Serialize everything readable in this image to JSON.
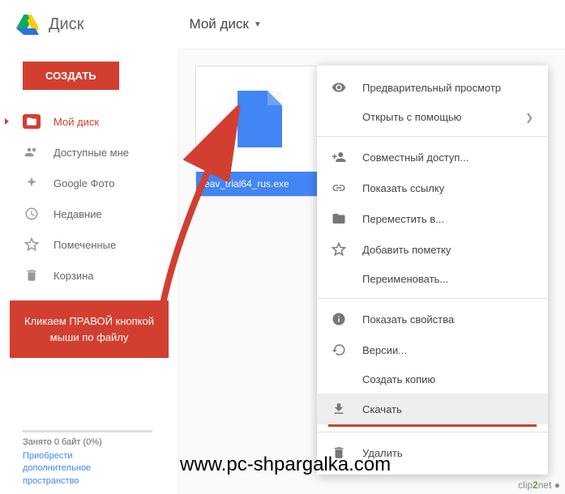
{
  "app_name": "Диск",
  "location": "Мой диск",
  "create_button": "СОЗДАТЬ",
  "sidebar": {
    "items": [
      {
        "label": "Мой диск",
        "icon": "folder"
      },
      {
        "label": "Доступные мне",
        "icon": "shared"
      },
      {
        "label": "Google Фото",
        "icon": "photos"
      },
      {
        "label": "Недавние",
        "icon": "recent"
      },
      {
        "label": "Помеченные",
        "icon": "star"
      },
      {
        "label": "Корзина",
        "icon": "trash"
      }
    ]
  },
  "annotation": {
    "line1": "Кликаем ПРАВОЙ кнопкой",
    "line2": "мыши по файлу"
  },
  "storage": {
    "used": "Занято 0 байт (0%)",
    "link_line1": "Приобрести",
    "link_line2": "дополнительное",
    "link_line3": "пространство"
  },
  "file": {
    "name": "eav_trial64_rus.exe"
  },
  "context_menu": [
    {
      "label": "Предварительный просмотр",
      "icon": "eye"
    },
    {
      "label": "Открыть с помощью",
      "icon": "",
      "chevron": true
    },
    {
      "sep": true
    },
    {
      "label": "Совместный доступ...",
      "icon": "add-person"
    },
    {
      "label": "Показать ссылку",
      "icon": "link"
    },
    {
      "label": "Переместить в...",
      "icon": "folder-solid"
    },
    {
      "label": "Добавить пометку",
      "icon": "star"
    },
    {
      "label": "Переименовать...",
      "icon": ""
    },
    {
      "sep": true
    },
    {
      "label": "Показать свойства",
      "icon": "info"
    },
    {
      "label": "Версии...",
      "icon": "versions"
    },
    {
      "label": "Создать копию",
      "icon": ""
    },
    {
      "label": "Скачать",
      "icon": "download",
      "highlighted": true,
      "underline": true
    },
    {
      "sep": true
    },
    {
      "label": "Удалить",
      "icon": "trash"
    }
  ],
  "watermark": "www.pc-shpargalka.com",
  "clip2net": {
    "p1": "clip",
    "p2": "2",
    "p3": "net ●"
  }
}
